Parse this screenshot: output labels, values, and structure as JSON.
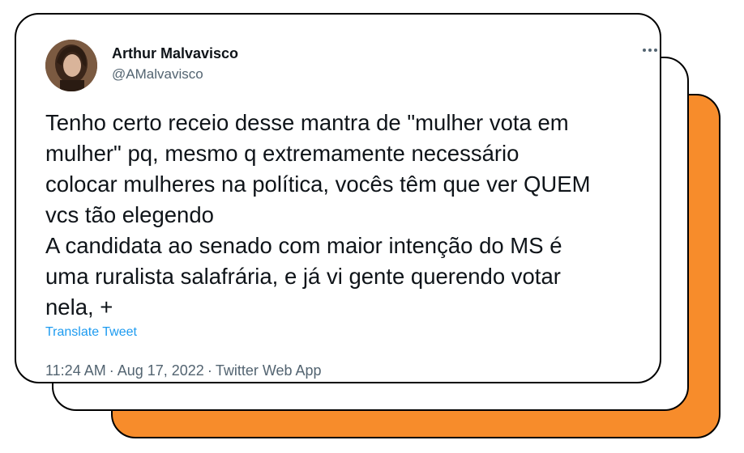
{
  "colors": {
    "accent_card": "#f78c2b",
    "link": "#1d9bf0",
    "text_primary": "#0f1419",
    "text_secondary": "#536471"
  },
  "author": {
    "name": "Arthur Malvavisco",
    "handle": "@AMalvavisco"
  },
  "more_icon": "more-horizontal-icon",
  "tweet": {
    "lines": [
      "Tenho certo receio desse mantra de \"mulher vota em",
      "mulher\" pq, mesmo q extremamente necessário",
      "colocar mulheres na política, vocês têm que ver QUEM",
      "vcs tão elegendo",
      "A candidata ao senado com maior intenção do MS é",
      "uma ruralista salafrária, e já vi gente querendo votar",
      "nela, +"
    ],
    "translate_label": "Translate Tweet",
    "time": "11:24 AM",
    "date": "Aug 17, 2022",
    "source": "Twitter Web App",
    "separator": "·"
  }
}
